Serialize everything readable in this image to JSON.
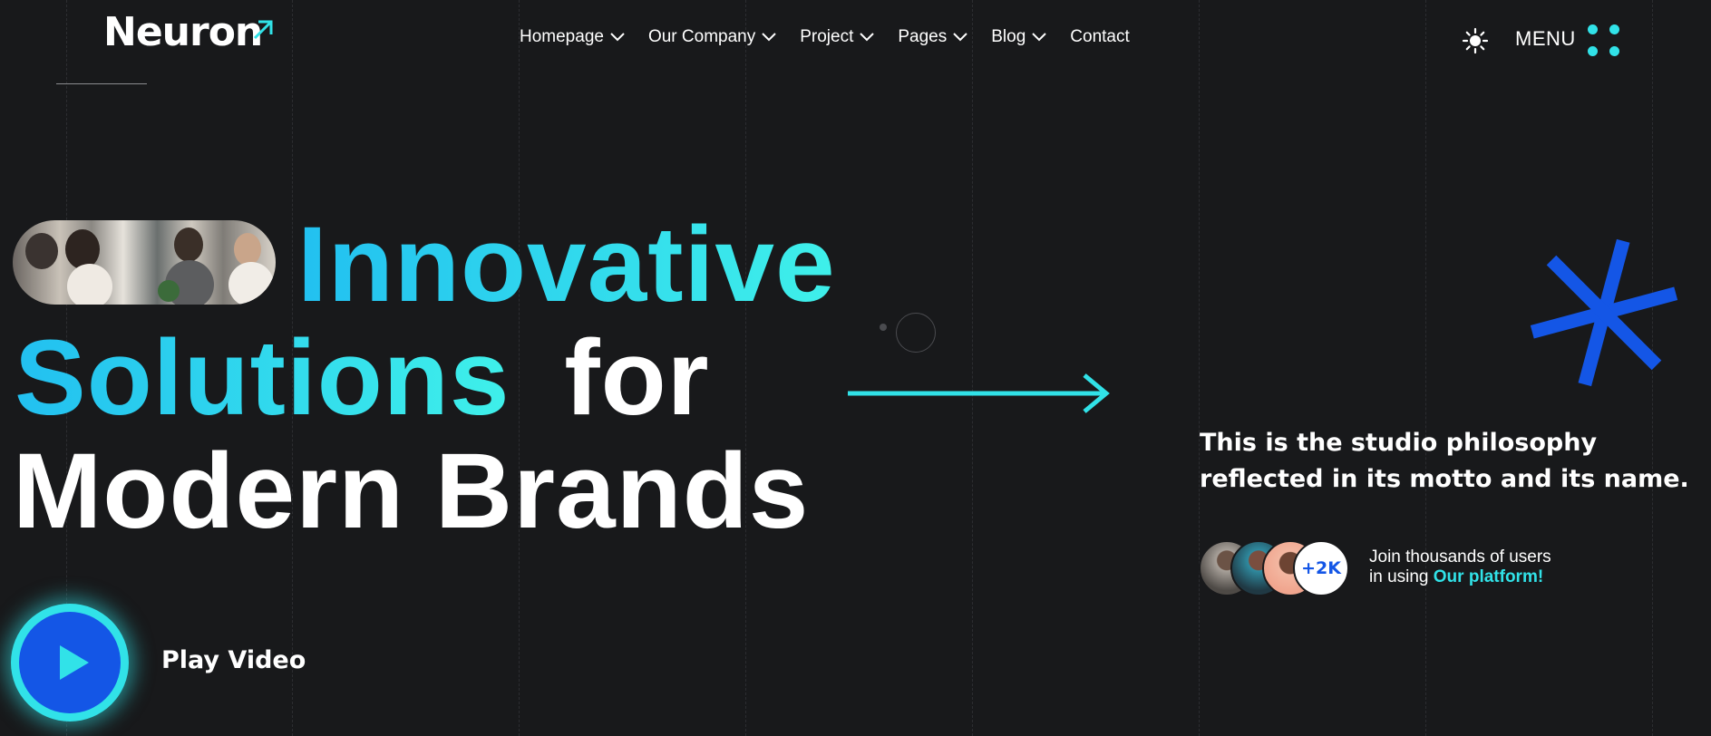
{
  "header": {
    "logo": "Neuron",
    "nav": [
      {
        "label": "Homepage",
        "dropdown": true
      },
      {
        "label": "Our Company",
        "dropdown": true
      },
      {
        "label": "Project",
        "dropdown": true
      },
      {
        "label": "Pages",
        "dropdown": true
      },
      {
        "label": "Blog",
        "dropdown": true
      },
      {
        "label": "Contact",
        "dropdown": false
      }
    ],
    "theme_toggle_icon": "sun-icon",
    "menu_label": "MENU",
    "menu_icon": "four-dots-icon"
  },
  "hero": {
    "line1": "Innovative",
    "line2_accent": "Solutions",
    "line2_rest": "for",
    "line3": "Modern Brands",
    "image": "team-meeting-photo",
    "play_label": "Play Video"
  },
  "aside": {
    "philosophy": "This is the studio philosophy reflected in its motto and its name.",
    "avatar_count": "+2K",
    "join_text": "Join thousands of users",
    "join_text2": "in using",
    "join_link": "Our platform!"
  },
  "colors": {
    "background": "#18191b",
    "accent_cyan": "#31e2e8",
    "accent_blue": "#1456e6",
    "gradient_start": "#22c0f0"
  }
}
